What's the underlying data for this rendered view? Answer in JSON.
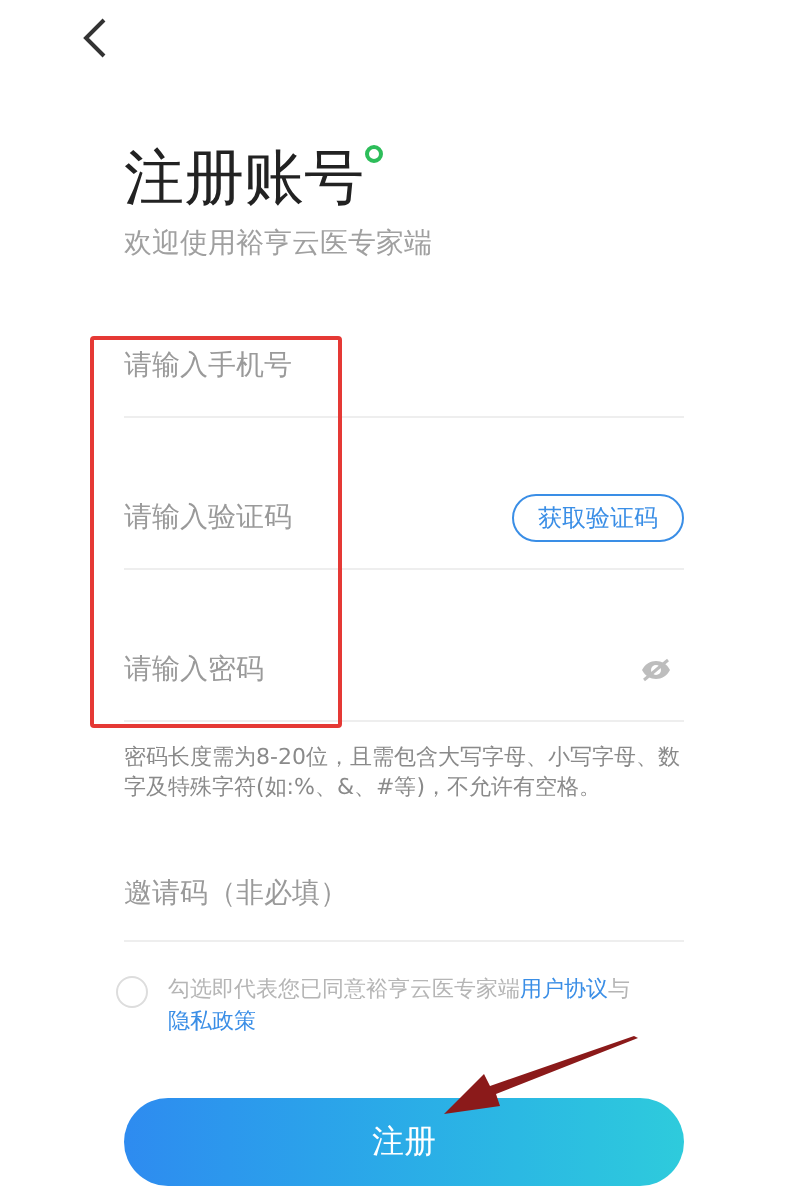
{
  "title": "注册账号",
  "subtitle": "欢迎使用裕亨云医专家端",
  "fields": [
    {
      "kind": "phone",
      "placeholder": "请输入手机号"
    },
    {
      "kind": "code",
      "placeholder": "请输入验证码",
      "action": "获取验证码"
    },
    {
      "kind": "password",
      "placeholder": "请输入密码"
    }
  ],
  "password_hint": "密码长度需为8-20位，且需包含大写字母、小写字母、数字及特殊字符(如:%、&、#等)，不允许有空格。",
  "invite_field": {
    "placeholder": "邀请码（非必填）"
  },
  "agreement": {
    "checked": false,
    "text": "勾选即代表您已同意裕亨云医专家端",
    "links": [
      {
        "label": "用户协议"
      },
      {
        "label": "隐私政策"
      }
    ],
    "connector": "与"
  },
  "register_button": "注册"
}
